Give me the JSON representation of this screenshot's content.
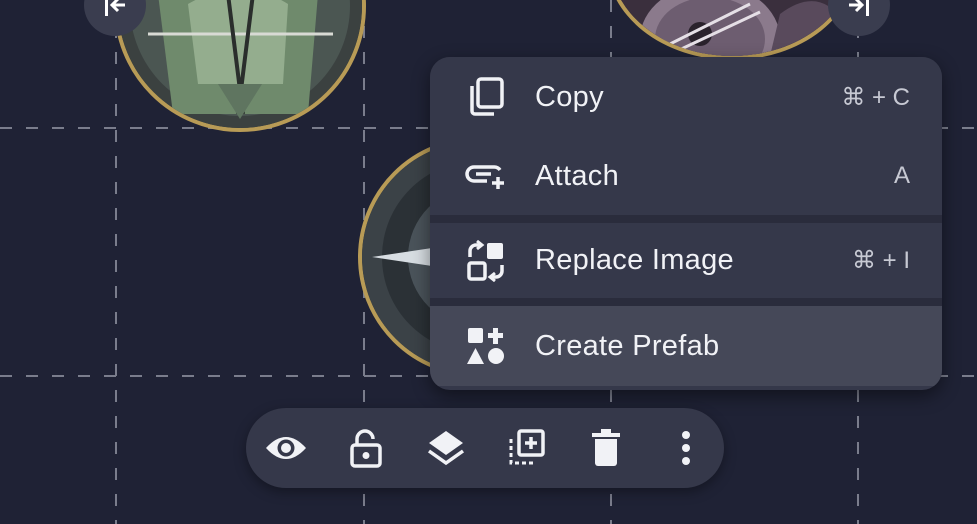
{
  "context_menu": {
    "items": [
      {
        "label": "Copy",
        "shortcut": "⌘ + C",
        "icon": "copy-icon"
      },
      {
        "label": "Attach",
        "shortcut": "A",
        "icon": "attach-icon"
      },
      {
        "label": "Replace Image",
        "shortcut": "⌘ + I",
        "icon": "replace-image-icon"
      },
      {
        "label": "Create Prefab",
        "shortcut": "",
        "icon": "create-prefab-icon"
      }
    ]
  },
  "toolbar": {
    "buttons": [
      "eye-icon",
      "unlock-icon",
      "layers-icon",
      "duplicate-icon",
      "trash-icon",
      "more-vertical-icon"
    ]
  },
  "corner_buttons": [
    "collapse-left-icon",
    "collapse-right-icon"
  ],
  "colors": {
    "canvas_bg": "#1f2235",
    "menu_bg": "#35384a",
    "menu_highlight": "#454858",
    "token_rim": "#b89b56",
    "text": "#f1f2f6"
  }
}
